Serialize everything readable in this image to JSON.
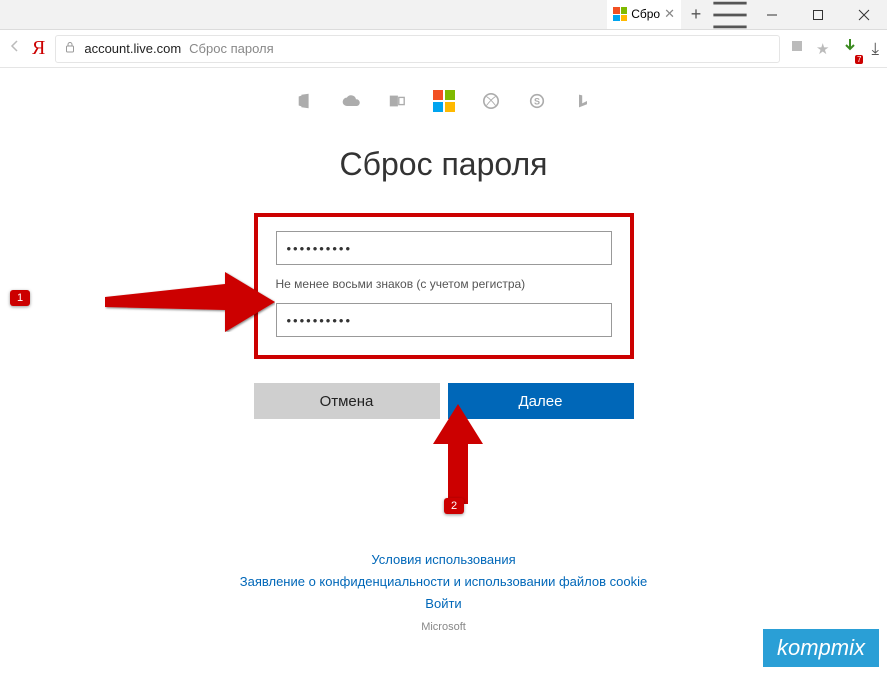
{
  "window": {
    "tab_title": "Сбро",
    "newtab_glyph": "+"
  },
  "addr": {
    "brand": "Я",
    "host": "account.live.com",
    "page_label": "Сброс пароля"
  },
  "ext_badge": "7",
  "page": {
    "heading": "Сброс пароля",
    "pw1": "••••••••••",
    "pw2": "••••••••••",
    "hint": "Не менее восьми знаков (с учетом регистра)",
    "cancel": "Отмена",
    "next": "Далее"
  },
  "callouts": {
    "one": "1",
    "two": "2"
  },
  "footer": {
    "terms": "Условия использования",
    "privacy": "Заявление о конфиденциальности и использовании файлов cookie",
    "signin": "Войти",
    "corp": "Microsoft"
  },
  "watermark": "kompmix"
}
